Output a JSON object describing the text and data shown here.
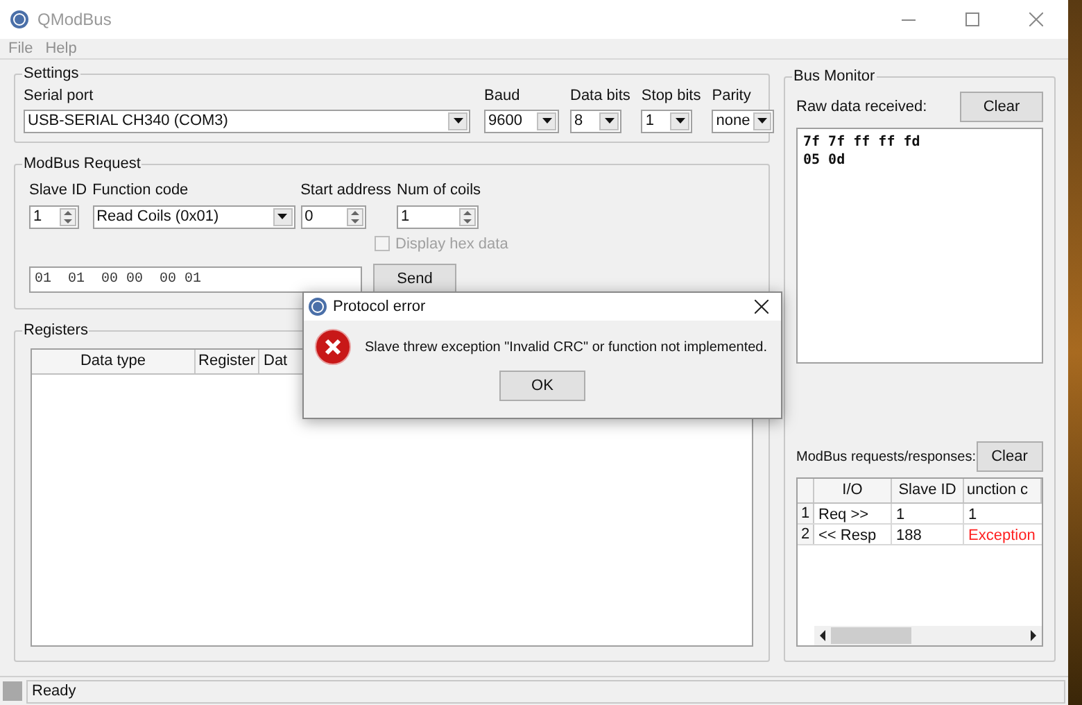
{
  "window": {
    "title": "QModBus"
  },
  "menu": [
    {
      "label": "File"
    },
    {
      "label": "Help"
    }
  ],
  "settings": {
    "title": "Settings",
    "fields": [
      {
        "label": "Serial port",
        "value": "USB-SERIAL CH340 (COM3)"
      },
      {
        "label": "Baud",
        "value": "9600"
      },
      {
        "label": "Data bits",
        "value": "8"
      },
      {
        "label": "Stop bits",
        "value": "1"
      },
      {
        "label": "Parity",
        "value": "none"
      }
    ]
  },
  "request": {
    "title": "ModBus Request",
    "fields": [
      {
        "label": "Slave ID",
        "kind": "spin",
        "value": "1"
      },
      {
        "label": "Function code",
        "kind": "combo",
        "value": "Read Coils (0x01)"
      },
      {
        "label": "Start address",
        "kind": "spin",
        "value": "0"
      },
      {
        "label": "Num of coils",
        "kind": "spin",
        "value": "1"
      }
    ],
    "hex_checkbox": {
      "label": "Display hex data",
      "checked": false,
      "disabled": true
    },
    "frame": "01  01  00 00  00 01",
    "send_button": "Send"
  },
  "registers": {
    "title": "Registers",
    "columns": [
      "Data type",
      "Register",
      "Dat"
    ]
  },
  "bus_monitor": {
    "title": "Bus Monitor",
    "raw_label": "Raw data received:",
    "raw_clear": "Clear",
    "raw_lines": [
      "7f 7f ff ff fd",
      "05 0d"
    ],
    "log_label": "ModBus requests/responses:",
    "log_clear": "Clear",
    "log_columns": [
      "I/O",
      "Slave ID",
      "unction c"
    ],
    "log_rows": [
      {
        "number": "1",
        "io": "Req >>",
        "slave_id": "1",
        "column_4": "1",
        "error": false
      },
      {
        "number": "2",
        "io": "<< Resp",
        "slave_id": "188",
        "column_4": "Exception",
        "error": true
      }
    ]
  },
  "status_bar": {
    "text": "Ready"
  },
  "dialog": {
    "title": "Protocol error",
    "message": "Slave threw exception \"Invalid CRC\" or function not implemented.",
    "ok_button": "OK"
  }
}
